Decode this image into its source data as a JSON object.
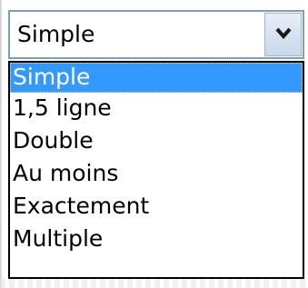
{
  "spacing_select": {
    "current_value": "Simple",
    "button_icon": "chevron-down-icon"
  },
  "dropdown": {
    "options": [
      {
        "label": "Simple",
        "selected": true
      },
      {
        "label": "1,5 ligne",
        "selected": false
      },
      {
        "label": "Double",
        "selected": false
      },
      {
        "label": "Au moins",
        "selected": false
      },
      {
        "label": "Exactement",
        "selected": false
      },
      {
        "label": "Multiple",
        "selected": false
      }
    ],
    "highlight_color": "#3399ff"
  }
}
